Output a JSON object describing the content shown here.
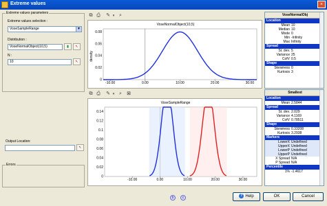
{
  "window": {
    "title": "Extreme values",
    "close_glyph": "×"
  },
  "params": {
    "group_label": "Extreme values parameters",
    "selection_label": "Extreme values selection :",
    "selection_value": "VoseSampleRange",
    "distribution_label": "Distribution :",
    "distribution_value": "VoseNormalObject(10,5)",
    "n_label": "N :",
    "n_value": "10"
  },
  "output": {
    "label": "Output Location:",
    "value": ""
  },
  "errors": {
    "label": "Errors"
  },
  "chart_data": [
    {
      "type": "line",
      "title": "VoseNormalObject(10,5)",
      "ylabel": "density",
      "xlabel": "",
      "xlim": [
        -12,
        32
      ],
      "ylim": [
        0,
        0.085
      ],
      "x_ticks": [
        "-10.00",
        "0.00",
        "10.00",
        "20.00",
        "30.00"
      ],
      "y_ticks": [
        "0",
        "0.02",
        "0.04",
        "0.06",
        "0.08"
      ],
      "series": [
        {
          "kind": "normal",
          "mean": 10,
          "sd": 5,
          "color": "#1f2ee0"
        }
      ]
    },
    {
      "type": "line",
      "title": "VoseSampleRange",
      "xlabel": "",
      "ylabel": "",
      "xlim": [
        -20,
        35
      ],
      "ylim": [
        0,
        0.15
      ],
      "x_ticks": [
        "-10.00",
        "0.00",
        "10.00",
        "20.00",
        "30.00"
      ],
      "y_ticks": [
        "0",
        "0.02",
        "0.04",
        "0.06",
        "0.08",
        "0.1",
        "0.12",
        "0.14"
      ],
      "series": [
        {
          "kind": "normal",
          "mean": 2.58,
          "sd": 2.03,
          "color": "#1f2ee0",
          "fill": "#d8e8ff"
        },
        {
          "kind": "normal",
          "mean": 17.5,
          "sd": 2.1,
          "color": "#e02020",
          "fill": "#ffe2e2"
        }
      ]
    }
  ],
  "panel_top": {
    "title": "VoseNormalObj",
    "sections": [
      {
        "name": "Location",
        "rows": [
          {
            "k": "Mean",
            "v": "10"
          },
          {
            "k": "Median",
            "v": "10"
          },
          {
            "k": "Mode",
            "v": "0"
          },
          {
            "k": "Min",
            "v": "-Infinity"
          },
          {
            "k": "Max",
            "v": "Infinity"
          }
        ]
      },
      {
        "name": "Spread",
        "rows": [
          {
            "k": "St. dev.",
            "v": "5"
          },
          {
            "k": "Variance",
            "v": "25"
          },
          {
            "k": "CofV",
            "v": "0.5"
          }
        ]
      },
      {
        "name": "Shape",
        "rows": [
          {
            "k": "Skewness",
            "v": "0"
          },
          {
            "k": "Kurtosis",
            "v": "3"
          }
        ]
      }
    ]
  },
  "panel_bottom": {
    "title": "Smallest",
    "sections": [
      {
        "name": "Location",
        "rows": [
          {
            "k": "Mean",
            "v": "2.5844"
          }
        ]
      },
      {
        "name": "Spread",
        "rows": [
          {
            "k": "St. dev.",
            "v": "2.029"
          },
          {
            "k": "Variance",
            "v": "4.1169"
          },
          {
            "k": "CofV",
            "v": "0.78511"
          }
        ]
      },
      {
        "name": "Shape",
        "rows": [
          {
            "k": "Skewness",
            "v": "0.33208"
          },
          {
            "k": "Kurtosis",
            "v": "3.2938"
          }
        ]
      },
      {
        "name": "Markers",
        "rows": [
          {
            "k": "LowerX",
            "v": "Undefined",
            "hl": true
          },
          {
            "k": "UpperX",
            "v": "Undefined",
            "hl": true
          },
          {
            "k": "LowerP",
            "v": "Undefined",
            "hl": true
          },
          {
            "k": "UpperP",
            "v": "Undefined",
            "hl": true
          },
          {
            "k": "X Spread",
            "v": "N/A"
          },
          {
            "k": "P Spread",
            "v": "N/A"
          }
        ]
      },
      {
        "name": "Percentile",
        "rows": [
          {
            "k": "1%",
            "v": "-1.4617"
          }
        ]
      }
    ]
  },
  "buttons": {
    "help": "Help",
    "ok": "OK",
    "cancel": "Cancel"
  },
  "footer_icons": {
    "left": "b",
    "right": "c"
  }
}
